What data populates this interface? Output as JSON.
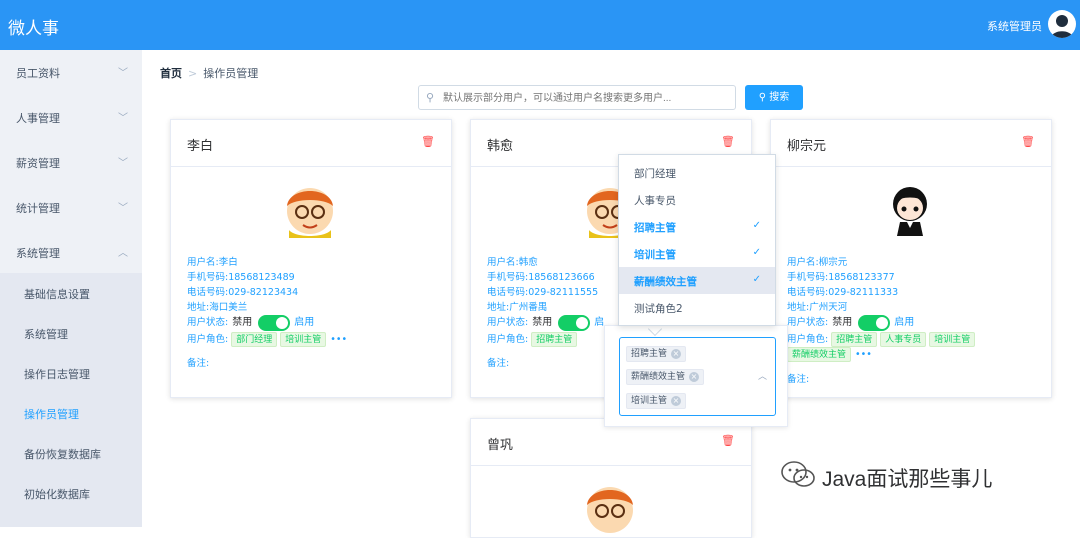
{
  "app": {
    "title": "微人事",
    "user_name": "系统管理员"
  },
  "sidebar": {
    "items": [
      {
        "label": "员工资料",
        "chevron": "chevron-down"
      },
      {
        "label": "人事管理",
        "chevron": "chevron-down"
      },
      {
        "label": "薪资管理",
        "chevron": "chevron-down"
      },
      {
        "label": "统计管理",
        "chevron": "chevron-down"
      },
      {
        "label": "系统管理",
        "chevron": "chevron-up"
      }
    ],
    "submenu": [
      {
        "label": "基础信息设置",
        "active": false
      },
      {
        "label": "系统管理",
        "active": false
      },
      {
        "label": "操作日志管理",
        "active": false
      },
      {
        "label": "操作员管理",
        "active": true
      },
      {
        "label": "备份恢复数据库",
        "active": false
      },
      {
        "label": "初始化数据库",
        "active": false
      }
    ]
  },
  "breadcrumb": {
    "home": "首页",
    "separator": ">",
    "current": "操作员管理"
  },
  "search": {
    "placeholder": "默认展示部分用户，可以通过用户名搜索更多用户...",
    "button_label": "搜索"
  },
  "cards": [
    {
      "name": "李白",
      "username": "用户名:李白",
      "phone": "手机号码:18568123489",
      "tel": "电话号码:029-82123434",
      "address": "地址:海口美兰",
      "status_label": "用户状态:",
      "status_off": "禁用",
      "status_on": "启用",
      "roles_label": "用户角色:",
      "roles": [
        "部门经理",
        "培训主管"
      ],
      "more": "•••",
      "remark": "备注:"
    },
    {
      "name": "韩愈",
      "username": "用户名:韩愈",
      "phone": "手机号码:18568123666",
      "tel": "电话号码:029-82111555",
      "address": "地址:广州番禺",
      "status_label": "用户状态:",
      "status_off": "禁用",
      "status_on": "启",
      "roles_label": "用户角色:",
      "roles": [
        "招聘主管"
      ],
      "more": "",
      "remark": "备注:"
    },
    {
      "name": "柳宗元",
      "username": "用户名:柳宗元",
      "phone": "手机号码:18568123377",
      "tel": "电话号码:029-82111333",
      "address": "地址:广州天河",
      "status_label": "用户状态:",
      "status_off": "禁用",
      "status_on": "启用",
      "roles_label": "用户角色:",
      "roles": [
        "招聘主管",
        "人事专员",
        "培训主管"
      ],
      "roles_row2": [
        "薪酬绩效主管"
      ],
      "more": "•••",
      "remark": "备注:"
    },
    {
      "name": "曾巩"
    }
  ],
  "role_dropdown": {
    "options": [
      {
        "label": "部门经理",
        "selected": false
      },
      {
        "label": "人事专员",
        "selected": false
      },
      {
        "label": "招聘主管",
        "selected": true
      },
      {
        "label": "培训主管",
        "selected": true
      },
      {
        "label": "薪酬绩效主管",
        "selected": true
      },
      {
        "label": "测试角色2",
        "selected": false
      }
    ],
    "check": "✓"
  },
  "multiselect": {
    "tags": [
      "招聘主管",
      "薪酬绩效主管",
      "培训主管"
    ],
    "remove": "×",
    "caret": "︿"
  },
  "watermark": {
    "text": "Java面试那些事儿"
  },
  "colors": {
    "topbar": "#2a95f5",
    "accent": "#20a0ff",
    "switch_on": "#13ce66",
    "delete": "#ff4949"
  }
}
